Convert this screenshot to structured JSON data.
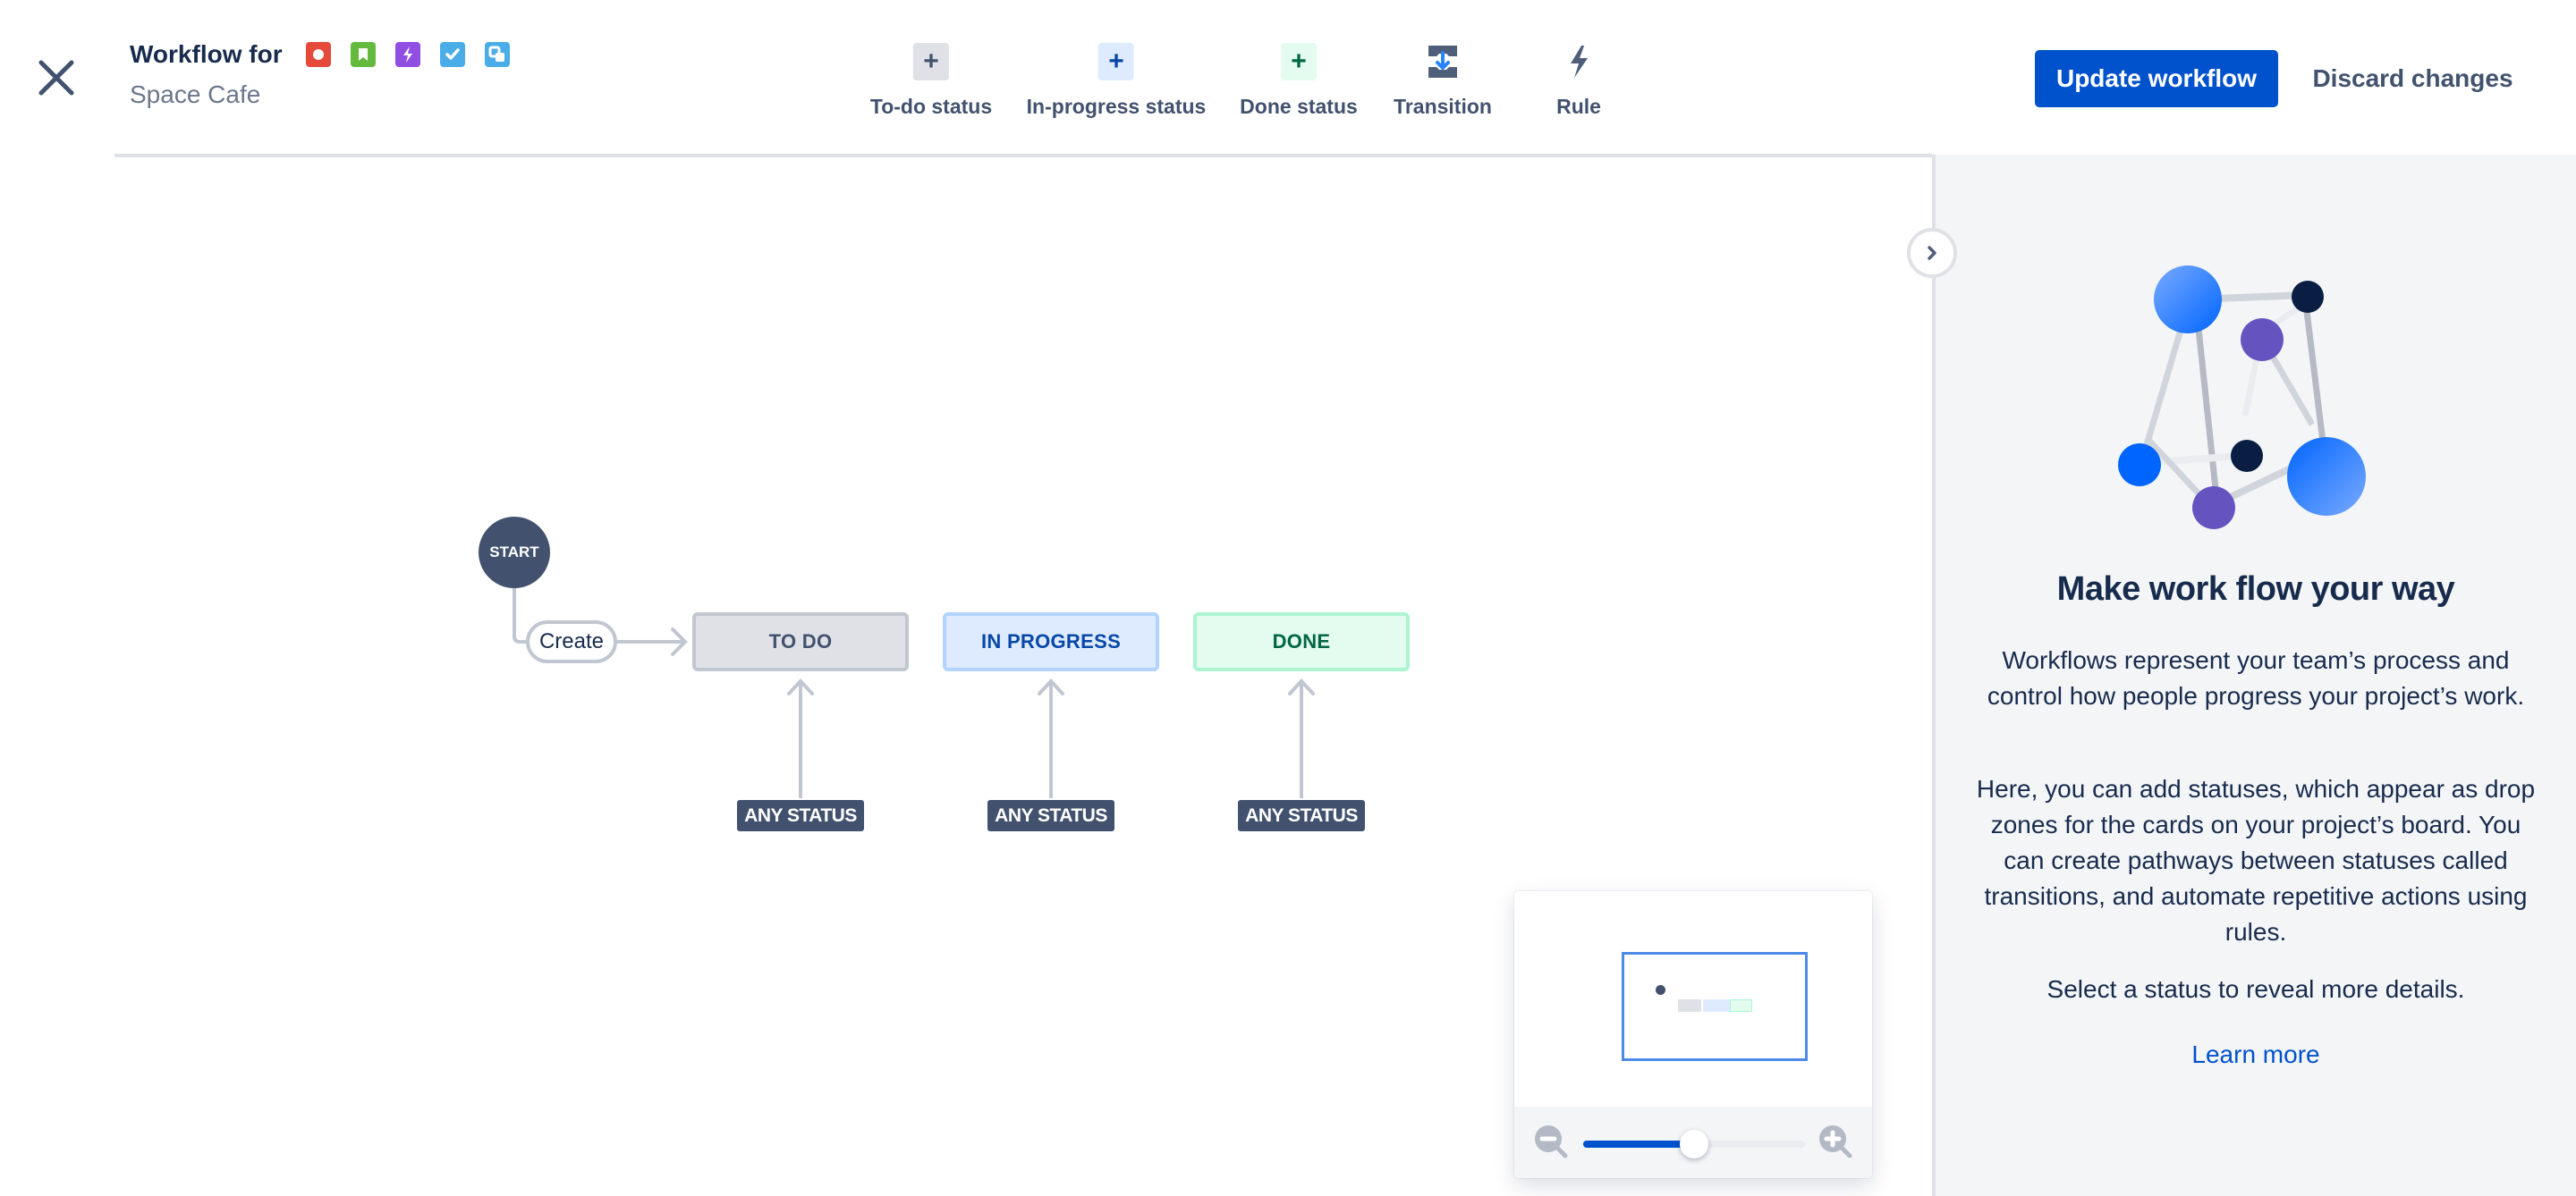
{
  "header": {
    "title": "Workflow for",
    "subtitle": "Space Cafe",
    "issue_type_icons": [
      {
        "name": "bug-icon",
        "color": "#e5493a"
      },
      {
        "name": "story-icon",
        "color": "#63ba3c"
      },
      {
        "name": "epic-icon",
        "color": "#904ee2"
      },
      {
        "name": "task-icon",
        "color": "#4bade8"
      },
      {
        "name": "subtask-icon",
        "color": "#4bade8"
      }
    ],
    "close_icon": "close-icon"
  },
  "toolbar": {
    "items": [
      {
        "label": "To-do status",
        "icon": "plus-icon",
        "icon_bg": "#dfe1e6",
        "icon_color": "#42526e"
      },
      {
        "label": "In-progress status",
        "icon": "plus-icon",
        "icon_bg": "#deebff",
        "icon_color": "#0747a6"
      },
      {
        "label": "Done status",
        "icon": "plus-icon",
        "icon_bg": "#e3fcef",
        "icon_color": "#006644"
      },
      {
        "label": "Transition",
        "icon": "transition-icon"
      },
      {
        "label": "Rule",
        "icon": "lightning-icon"
      }
    ]
  },
  "actions": {
    "update_label": "Update workflow",
    "discard_label": "Discard changes",
    "primary_color": "#0052cc"
  },
  "diagram": {
    "start_label": "START",
    "create_transition_label": "Create",
    "statuses": [
      {
        "label": "TO DO",
        "bg": "#dfe1e6",
        "border": "#c1c7d0",
        "color": "#42526e"
      },
      {
        "label": "IN PROGRESS",
        "bg": "#deebff",
        "border": "#b3d4ff",
        "color": "#0747a6"
      },
      {
        "label": "DONE",
        "bg": "#e3fcef",
        "border": "#abf5d1",
        "color": "#006644"
      }
    ],
    "any_status_label": "ANY STATUS"
  },
  "minimap": {
    "zoom_out_icon": "zoom-out-icon",
    "zoom_in_icon": "zoom-in-icon",
    "zoom_level_fraction": 0.5
  },
  "side_panel": {
    "heading": "Make work flow your way",
    "paragraphs": [
      "Workflows represent your team’s process and control how people progress your project’s work.",
      "Here, you can add statuses, which appear as drop zones for the cards on your project’s board. You can create pathways between statuses called transitions, and automate repetitive actions using rules.",
      "Select a status to reveal more details."
    ],
    "learn_more_label": "Learn more",
    "collapse_icon": "chevron-right-icon"
  }
}
